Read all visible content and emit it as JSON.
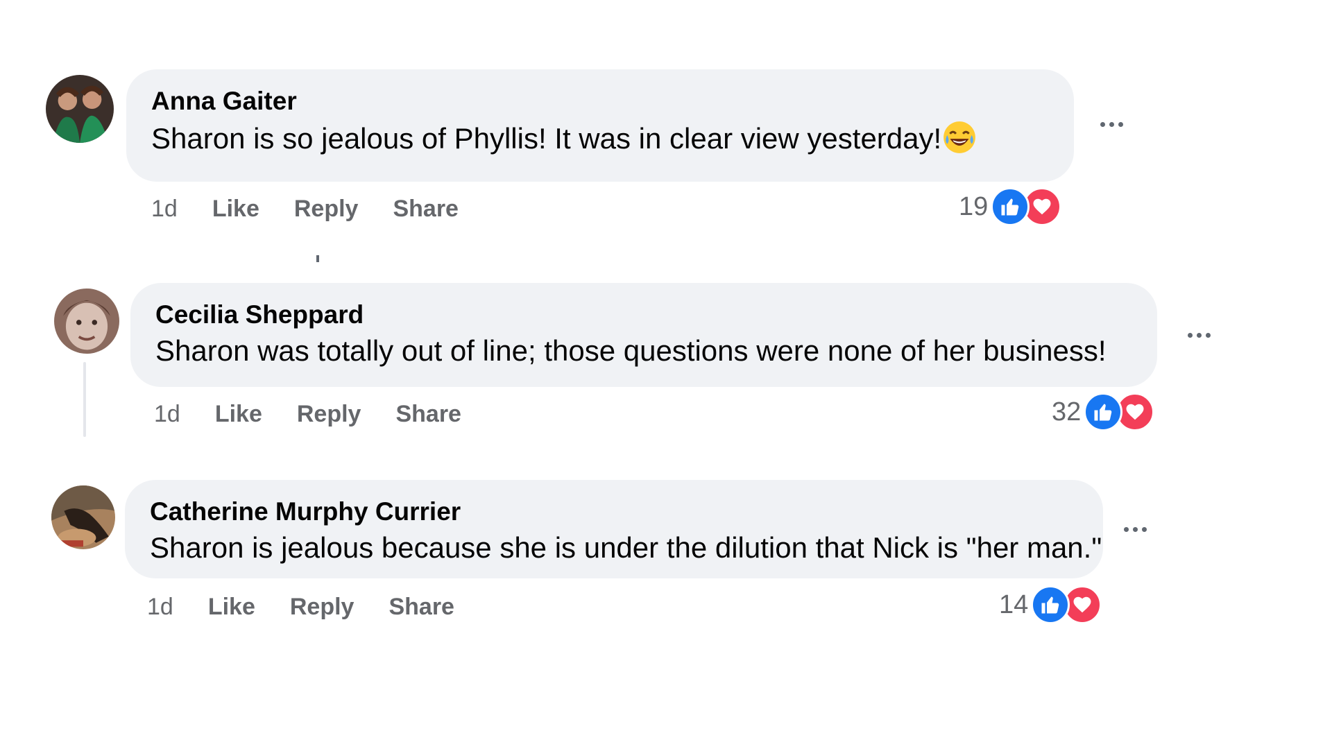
{
  "comments": [
    {
      "author": "Anna Gaiter",
      "text": "Sharon is so jealous of Phyllis! It was in clear view yesterday!",
      "emoji": "laughing-with-tears-emoji",
      "time": "1d",
      "like_label": "Like",
      "reply_label": "Reply",
      "share_label": "Share",
      "reaction_count": "19",
      "reactions": [
        "like-icon",
        "love-icon"
      ]
    },
    {
      "author": "Cecilia Sheppard",
      "text": "Sharon was totally out of line; those questions were none of her business!",
      "time": "1d",
      "like_label": "Like",
      "reply_label": "Reply",
      "share_label": "Share",
      "reaction_count": "32",
      "reactions": [
        "like-icon",
        "love-icon"
      ]
    },
    {
      "author": "Catherine Murphy Currier",
      "text": "Sharon is jealous because she is under the dilution that Nick is \"her man.\"",
      "time": "1d",
      "like_label": "Like",
      "reply_label": "Reply",
      "share_label": "Share",
      "reaction_count": "14",
      "reactions": [
        "like-icon",
        "love-icon"
      ]
    }
  ],
  "colors": {
    "bubble": "#f0f2f5",
    "like": "#1877f2",
    "love": "#f33e58",
    "meta_text": "#65676b"
  }
}
